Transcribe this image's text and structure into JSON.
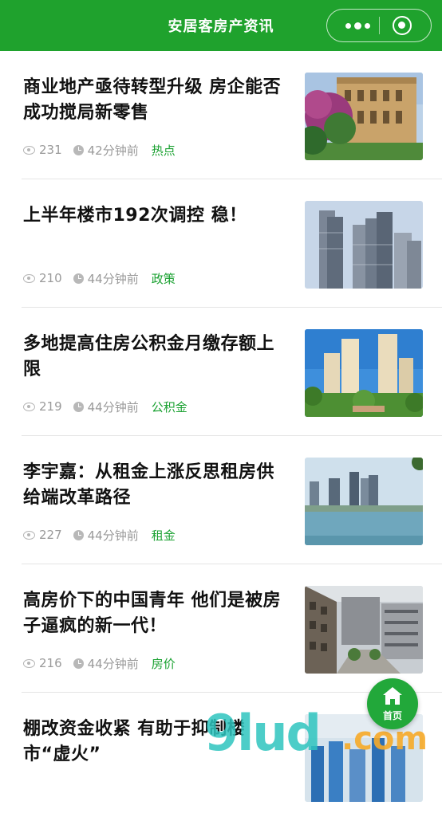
{
  "header": {
    "title": "安居客房产资讯",
    "more_icon": "more-dots-icon",
    "close_icon": "target-circle-icon"
  },
  "articles": [
    {
      "title": "商业地产亟待转型升级 房企能否成功搅局新零售",
      "views": "231",
      "time": "42分钟前",
      "tag": "热点",
      "thumb": "villa-building-photo"
    },
    {
      "title": "上半年楼市192次调控 稳！",
      "views": "210",
      "time": "44分钟前",
      "tag": "政策",
      "thumb": "skyscrapers-photo"
    },
    {
      "title": "多地提高住房公积金月缴存额上限",
      "views": "219",
      "time": "44分钟前",
      "tag": "公积金",
      "thumb": "residential-towers-photo"
    },
    {
      "title": "李宇嘉：从租金上涨反思租房供给端改革路径",
      "views": "227",
      "time": "44分钟前",
      "tag": "租金",
      "thumb": "lake-city-photo"
    },
    {
      "title": "高房价下的中国青年 他们是被房子逼疯的新一代！",
      "views": "216",
      "time": "44分钟前",
      "tag": "房价",
      "thumb": "street-buildings-photo"
    },
    {
      "title": "棚改资金收紧 有助于抑制楼市“虚火”",
      "views": "",
      "time": "",
      "tag": "",
      "thumb": "aerial-city-photo"
    }
  ],
  "fab": {
    "label": "首页",
    "icon": "home-icon"
  },
  "watermark": {
    "text": "9lud",
    "suffix": ".com"
  },
  "colors": {
    "brand_green": "#1fa22d",
    "tag_green": "#1aa131",
    "meta_gray": "#9a9a9a"
  }
}
